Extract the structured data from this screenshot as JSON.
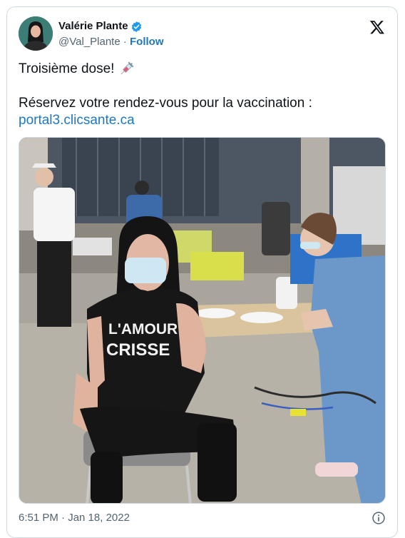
{
  "author": {
    "display_name": "Valérie Plante",
    "handle": "@Val_Plante",
    "separator": " · ",
    "follow_label": "Follow",
    "verified_icon": "verified-badge-icon",
    "avatar_icon": "avatar"
  },
  "platform_icon": "x-logo-icon",
  "tweet": {
    "line1": "Troisième dose!",
    "line1_emoji": "syringe-icon",
    "line2": "Réservez votre rendez-vous pour la vaccination :",
    "link": "portal3.clicsante.ca"
  },
  "media": {
    "shirt_text_1": "L'AMOUR",
    "shirt_text_2": "CRISSE"
  },
  "footer": {
    "timestamp": "6:51 PM · Jan 18, 2022",
    "info_icon": "info-icon"
  },
  "colors": {
    "link": "#1d78c1",
    "verified": "#1d9bf0",
    "secondary_text": "#536471",
    "border": "#cfd9de"
  }
}
